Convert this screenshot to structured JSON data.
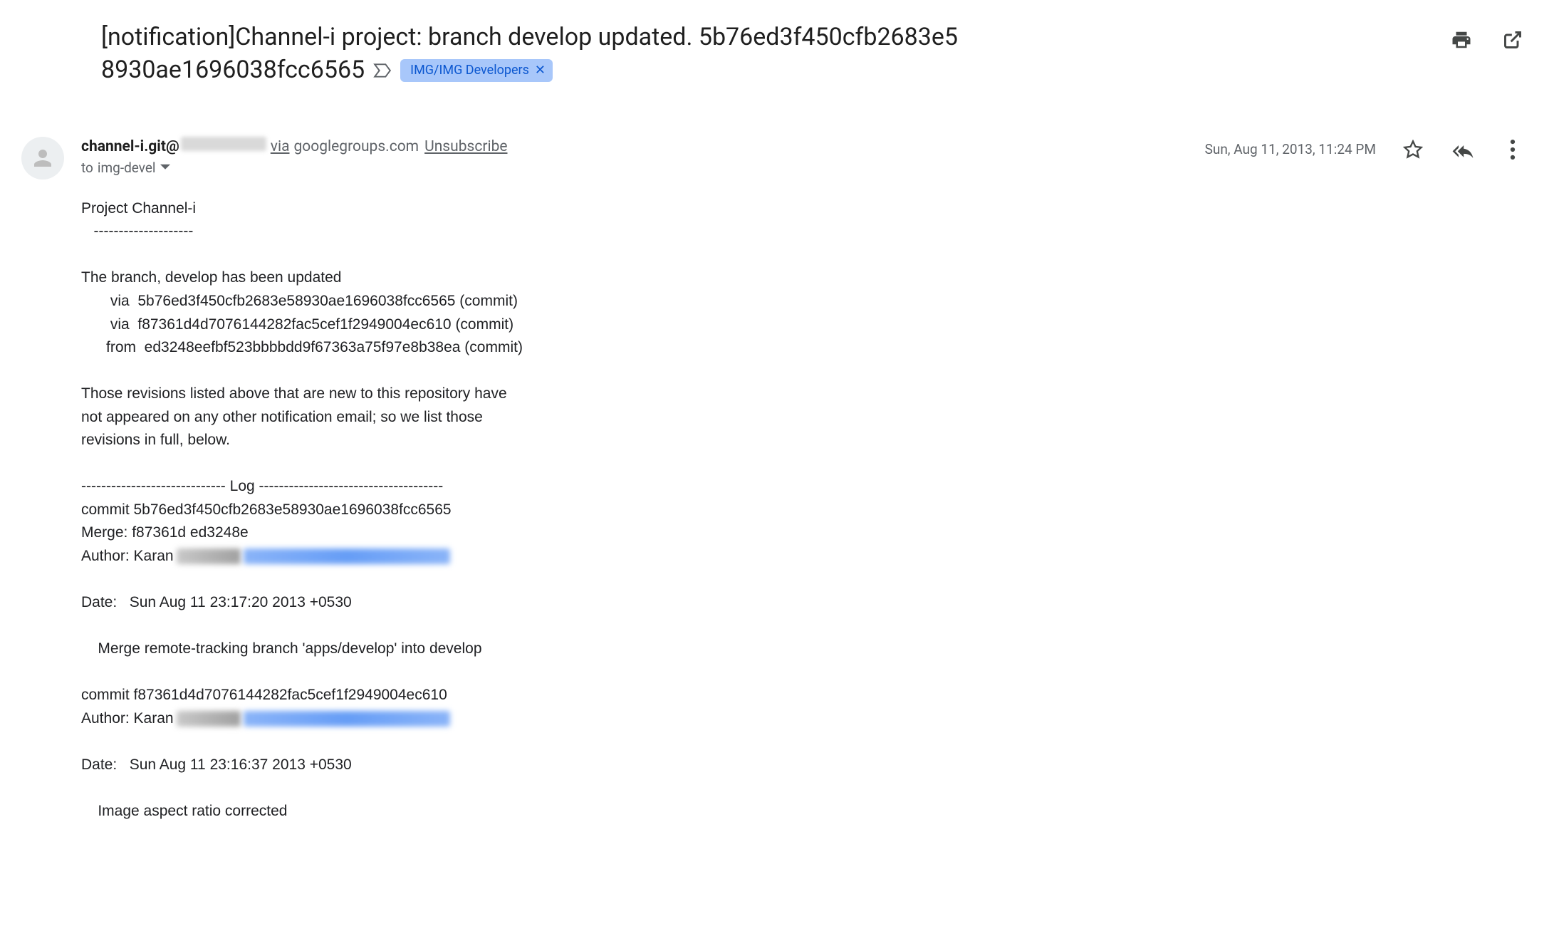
{
  "header": {
    "subject_line1": "[notification]Channel-i project: branch develop updated. 5b76ed3f450cfb2683e5",
    "subject_line2_text": "8930ae1696038fcc6565",
    "label": "IMG/IMG Developers"
  },
  "sender": {
    "name": "channel-i.git@",
    "via": "via",
    "via_domain": "googlegroups.com",
    "unsubscribe": "Unsubscribe",
    "to_prefix": "to",
    "to_value": "img-devel"
  },
  "meta": {
    "date": "Sun, Aug 11, 2013, 11:24 PM"
  },
  "body": {
    "l1": "Project Channel-i",
    "l2": "   --------------------",
    "l3": "",
    "l4": "The branch, develop has been updated",
    "l5": "       via  5b76ed3f450cfb2683e58930ae1696038fcc6565 (commit)",
    "l6": "       via  f87361d4d7076144282fac5cef1f2949004ec610 (commit)",
    "l7": "      from  ed3248eefbf523bbbbdd9f67363a75f97e8b38ea (commit)",
    "l8": "",
    "l9": "Those revisions listed above that are new to this repository have",
    "l10": "not appeared on any other notification email; so we list those",
    "l11": "revisions in full, below.",
    "l12": "",
    "l13": "----------------------------- Log -------------------------------------",
    "l14": "commit 5b76ed3f450cfb2683e58930ae1696038fcc6565",
    "l15": "Merge: f87361d ed3248e",
    "author_prefix": "Author: Karan",
    "l17": "Date:   Sun Aug 11 23:17:20 2013 +0530",
    "l18": "",
    "l19": "    Merge remote-tracking branch 'apps/develop' into develop",
    "l20": "",
    "l21": "commit f87361d4d7076144282fac5cef1f2949004ec610",
    "l23": "Date:   Sun Aug 11 23:16:37 2013 +0530",
    "l24": "",
    "l25": "    Image aspect ratio corrected"
  }
}
